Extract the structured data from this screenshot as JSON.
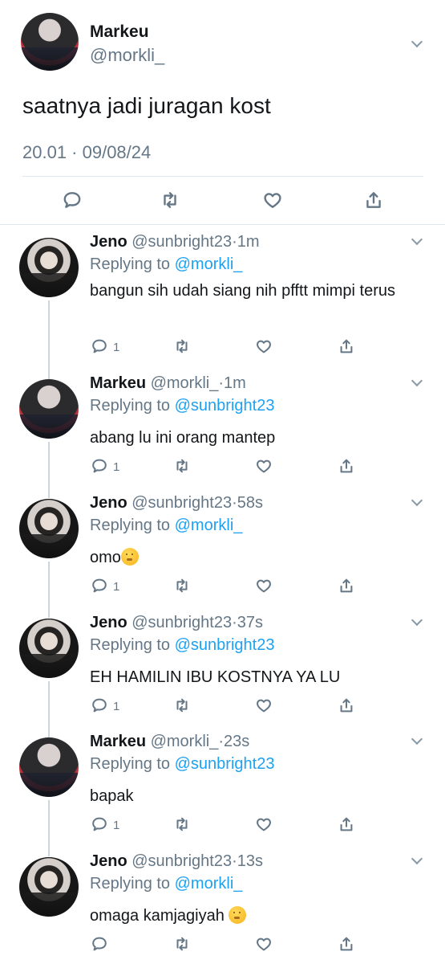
{
  "main_tweet": {
    "author_name": "Markeu",
    "handle": "@morkli_",
    "text": "saatnya jadi juragan kost",
    "timestamp": "20.01 · 09/08/24",
    "actions": [
      "reply-icon",
      "retweet-icon",
      "like-icon",
      "share-icon"
    ]
  },
  "replies": [
    {
      "name": "Jeno",
      "handle": "@sunbright23",
      "time": "1m",
      "replying_label": "Replying to",
      "replying_to": "@morkli_",
      "text": "bangun sih udah siang nih pfftt mimpi terus",
      "reply_count": "1"
    },
    {
      "name": "Markeu",
      "handle": "@morkli_",
      "time": "1m",
      "replying_label": "Replying to",
      "replying_to": "@sunbright23",
      "text": "abang lu ini orang mantep",
      "reply_count": "1"
    },
    {
      "name": "Jeno",
      "handle": "@sunbright23",
      "time": "58s",
      "replying_label": "Replying to",
      "replying_to": "@morkli_",
      "text": "omo",
      "emoji": "shushing-face",
      "reply_count": "1"
    },
    {
      "name": "Jeno",
      "handle": "@sunbright23",
      "time": "37s",
      "replying_label": "Replying to",
      "replying_to": "@sunbright23",
      "text": "EH HAMILIN IBU KOSTNYA YA LU",
      "reply_count": "1"
    },
    {
      "name": "Markeu",
      "handle": "@morkli_",
      "time": "23s",
      "replying_label": "Replying to",
      "replying_to": "@sunbright23",
      "text": "bapak",
      "reply_count": "1"
    },
    {
      "name": "Jeno",
      "handle": "@sunbright23",
      "time": "13s",
      "replying_label": "Replying to",
      "replying_to": "@morkli_",
      "text": "omaga kamjagiyah",
      "emoji": "shushing-face",
      "reply_count": ""
    }
  ],
  "colors": {
    "text": "#14171a",
    "secondary": "#657786",
    "link": "#1da1f2",
    "divider": "#e1e8ed",
    "thread_line": "#ccd6dd"
  }
}
